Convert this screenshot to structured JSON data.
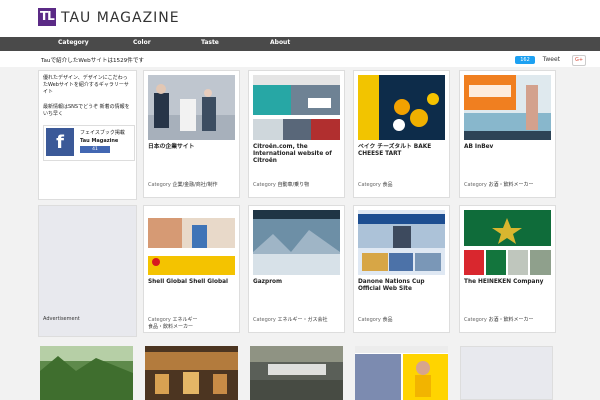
{
  "brand": {
    "name": "TAU MAGAZINE",
    "logo": "TL"
  },
  "nav": [
    {
      "label": "Category"
    },
    {
      "label": "Color"
    },
    {
      "label": "Taste"
    },
    {
      "label": "About"
    }
  ],
  "intro": {
    "text": "Tauで紹介したWebサイトは1529件です"
  },
  "share": {
    "count": "162",
    "tweet": "Tweet",
    "gplus": "G+"
  },
  "side": {
    "desc": "優れたデザイン、デザインにこだわったWebサイトを紹介するギャラリーサイト",
    "follow": "最新情報はSNSでどうぞ 新着の情報をいち早く",
    "fb_name": "フェイスブック掲載",
    "fb_page": "Tau Magazine",
    "fb_like": "41"
  },
  "ad": {
    "label": "Advertisement"
  },
  "cards": [
    {
      "title": "日本の企業サイト",
      "cat_label": "Category",
      "cat": "企業/金融/商社/制作"
    },
    {
      "title": "Citroën.com, the International website of Citroën",
      "cat_label": "Category",
      "cat": "自動車/乗り物"
    },
    {
      "title": "ベイク チーズタルト BAKE CHEESE TART",
      "cat_label": "Category",
      "cat": "食品"
    },
    {
      "title": "AB InBev",
      "cat_label": "Category",
      "cat": "お酒・飲料メーカー"
    },
    {
      "title": "Shell Global Shell Global",
      "cat_label": "Category",
      "cat": "エネルギー"
    },
    {
      "title": "Gazprom",
      "cat_label": "Category",
      "cat": "エネルギー・ガス会社"
    },
    {
      "title": "Danone Nations Cup Official Web Site",
      "cat_label": "Category",
      "cat": "食品"
    },
    {
      "title": "The HEINEKEN Company",
      "cat_label": "Category",
      "cat": "お酒・飲料メーカー"
    }
  ],
  "cat_extra": "食品・飲料メーカー"
}
